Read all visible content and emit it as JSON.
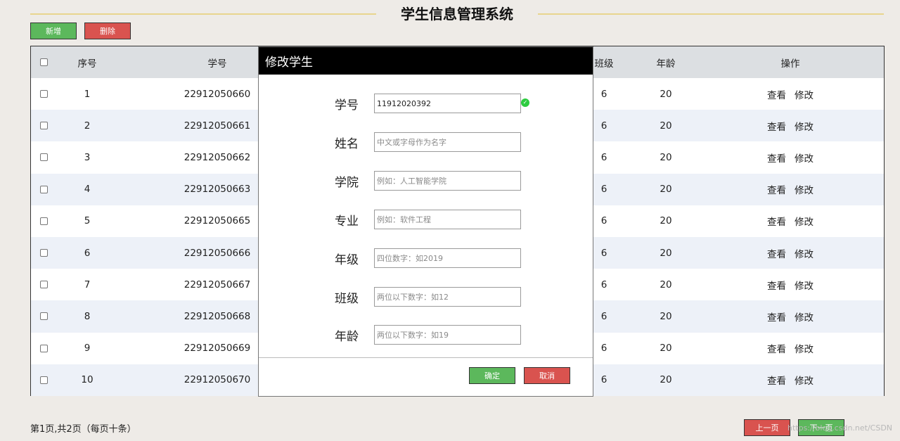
{
  "app": {
    "title": "学生信息管理系统"
  },
  "toolbar": {
    "add_label": "新增",
    "delete_label": "删除"
  },
  "table": {
    "headers": {
      "no": "序号",
      "sid": "学号",
      "cls": "班级",
      "age": "年龄",
      "op": "操作"
    },
    "rows": [
      {
        "no": "1",
        "sid": "22912050660",
        "cls": "6",
        "age": "20"
      },
      {
        "no": "2",
        "sid": "22912050661",
        "cls": "6",
        "age": "20"
      },
      {
        "no": "3",
        "sid": "22912050662",
        "cls": "6",
        "age": "20"
      },
      {
        "no": "4",
        "sid": "22912050663",
        "cls": "6",
        "age": "20"
      },
      {
        "no": "5",
        "sid": "22912050665",
        "cls": "6",
        "age": "20"
      },
      {
        "no": "6",
        "sid": "22912050666",
        "cls": "6",
        "age": "20"
      },
      {
        "no": "7",
        "sid": "22912050667",
        "cls": "6",
        "age": "20"
      },
      {
        "no": "8",
        "sid": "22912050668",
        "cls": "6",
        "age": "20"
      },
      {
        "no": "9",
        "sid": "22912050669",
        "cls": "6",
        "age": "20"
      },
      {
        "no": "10",
        "sid": "22912050670",
        "cls": "6",
        "age": "20"
      }
    ],
    "actions": {
      "view": "查看",
      "edit": "修改"
    }
  },
  "modal": {
    "title": "修改学生",
    "fields": {
      "sid": {
        "label": "学号",
        "value": "11912020392",
        "placeholder": ""
      },
      "name": {
        "label": "姓名",
        "value": "",
        "placeholder": "中文或字母作为名字"
      },
      "college": {
        "label": "学院",
        "value": "",
        "placeholder": "例如：人工智能学院"
      },
      "major": {
        "label": "专业",
        "value": "",
        "placeholder": "例如：软件工程"
      },
      "grade": {
        "label": "年级",
        "value": "",
        "placeholder": "四位数字：如2019"
      },
      "cls": {
        "label": "班级",
        "value": "",
        "placeholder": "两位以下数字：如12"
      },
      "age": {
        "label": "年龄",
        "value": "",
        "placeholder": "两位以下数字：如19"
      }
    },
    "confirm_label": "确定",
    "cancel_label": "取消",
    "valid_icon": "check-circle-icon"
  },
  "pagination": {
    "info": "第1页,共2页（每页十条）",
    "prev_label": "上一页",
    "next_label": "下一页"
  },
  "watermark": "https://blog.csdn.net/CSDN"
}
